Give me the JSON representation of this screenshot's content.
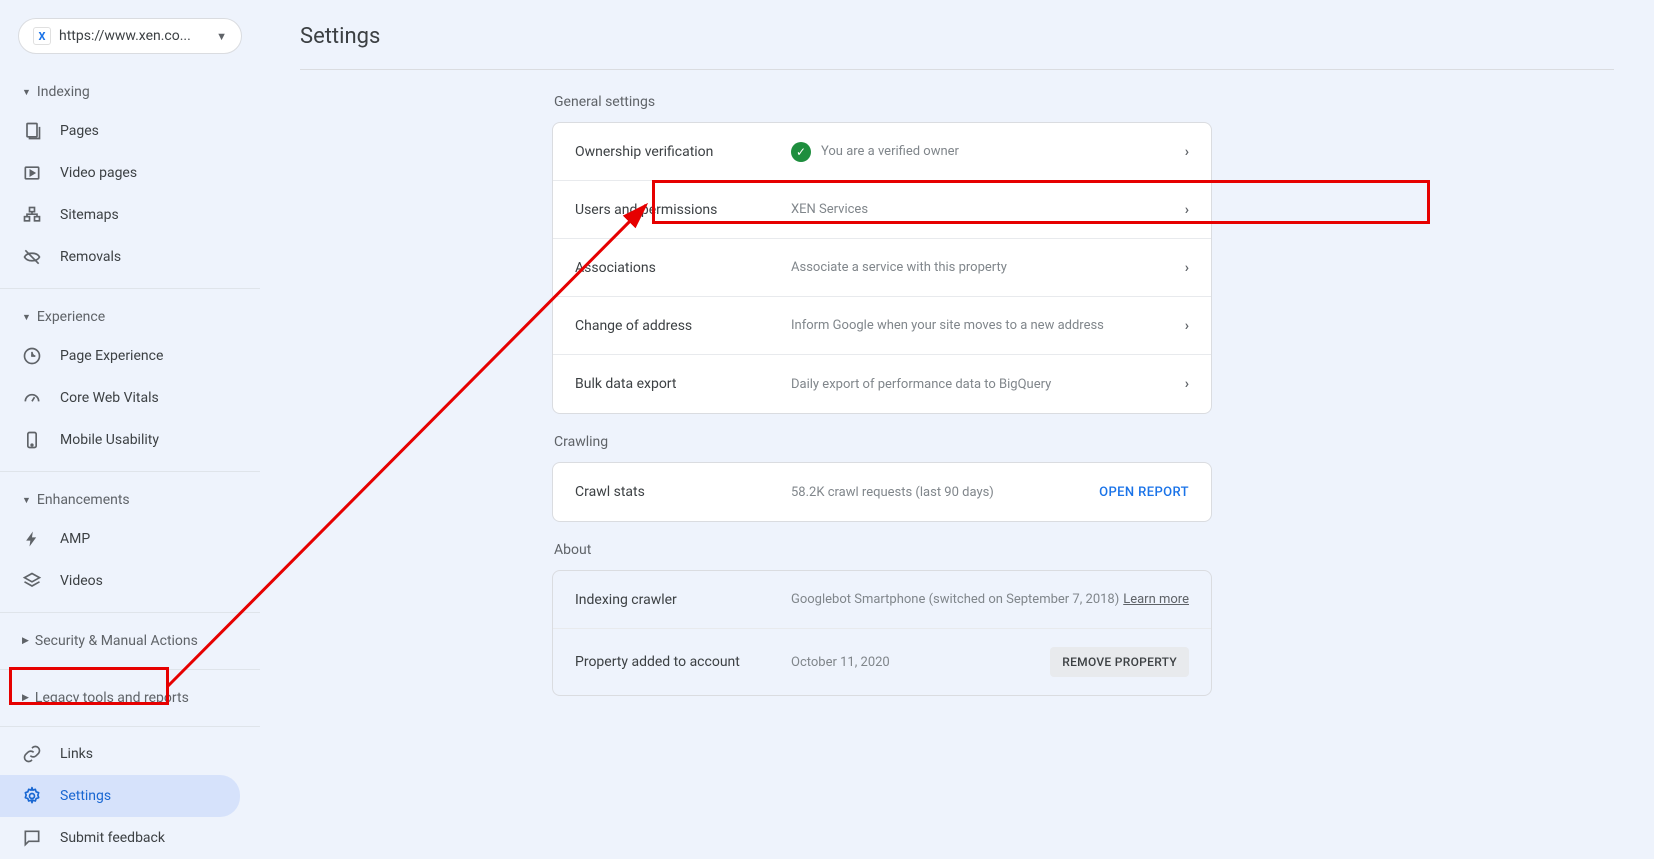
{
  "property": {
    "url": "https://www.xen.co...",
    "favicon_letter": "X"
  },
  "page_title": "Settings",
  "nav": {
    "sections": [
      {
        "header": "Indexing",
        "items": [
          {
            "label": "Pages",
            "icon": "pages"
          },
          {
            "label": "Video pages",
            "icon": "video"
          },
          {
            "label": "Sitemaps",
            "icon": "sitemaps"
          },
          {
            "label": "Removals",
            "icon": "removals"
          }
        ]
      },
      {
        "header": "Experience",
        "items": [
          {
            "label": "Page Experience",
            "icon": "page-exp"
          },
          {
            "label": "Core Web Vitals",
            "icon": "cwv"
          },
          {
            "label": "Mobile Usability",
            "icon": "mobile"
          }
        ]
      },
      {
        "header": "Enhancements",
        "items": [
          {
            "label": "AMP",
            "icon": "amp"
          },
          {
            "label": "Videos",
            "icon": "videos"
          }
        ]
      },
      {
        "header": "Security & Manual Actions",
        "items": []
      },
      {
        "header": "Legacy tools and reports",
        "items": []
      }
    ],
    "bottom": [
      {
        "label": "Links",
        "icon": "links"
      },
      {
        "label": "Settings",
        "icon": "settings",
        "active": true
      },
      {
        "label": "Submit feedback",
        "icon": "feedback"
      }
    ]
  },
  "sections": {
    "general": {
      "title": "General settings",
      "rows": [
        {
          "label": "Ownership verification",
          "value": "You are a verified owner",
          "verified": true
        },
        {
          "label": "Users and permissions",
          "value": "XEN Services"
        },
        {
          "label": "Associations",
          "value": "Associate a service with this property"
        },
        {
          "label": "Change of address",
          "value": "Inform Google when your site moves to a new address"
        },
        {
          "label": "Bulk data export",
          "value": "Daily export of performance data to BigQuery"
        }
      ]
    },
    "crawling": {
      "title": "Crawling",
      "rows": [
        {
          "label": "Crawl stats",
          "value": "58.2K crawl requests (last 90 days)",
          "action": "OPEN REPORT"
        }
      ]
    },
    "about": {
      "title": "About",
      "rows": [
        {
          "label": "Indexing crawler",
          "value": "Googlebot Smartphone (switched on September 7, 2018)",
          "link": "Learn more"
        },
        {
          "label": "Property added to account",
          "value": "October 11, 2020",
          "button": "REMOVE PROPERTY"
        }
      ]
    }
  }
}
